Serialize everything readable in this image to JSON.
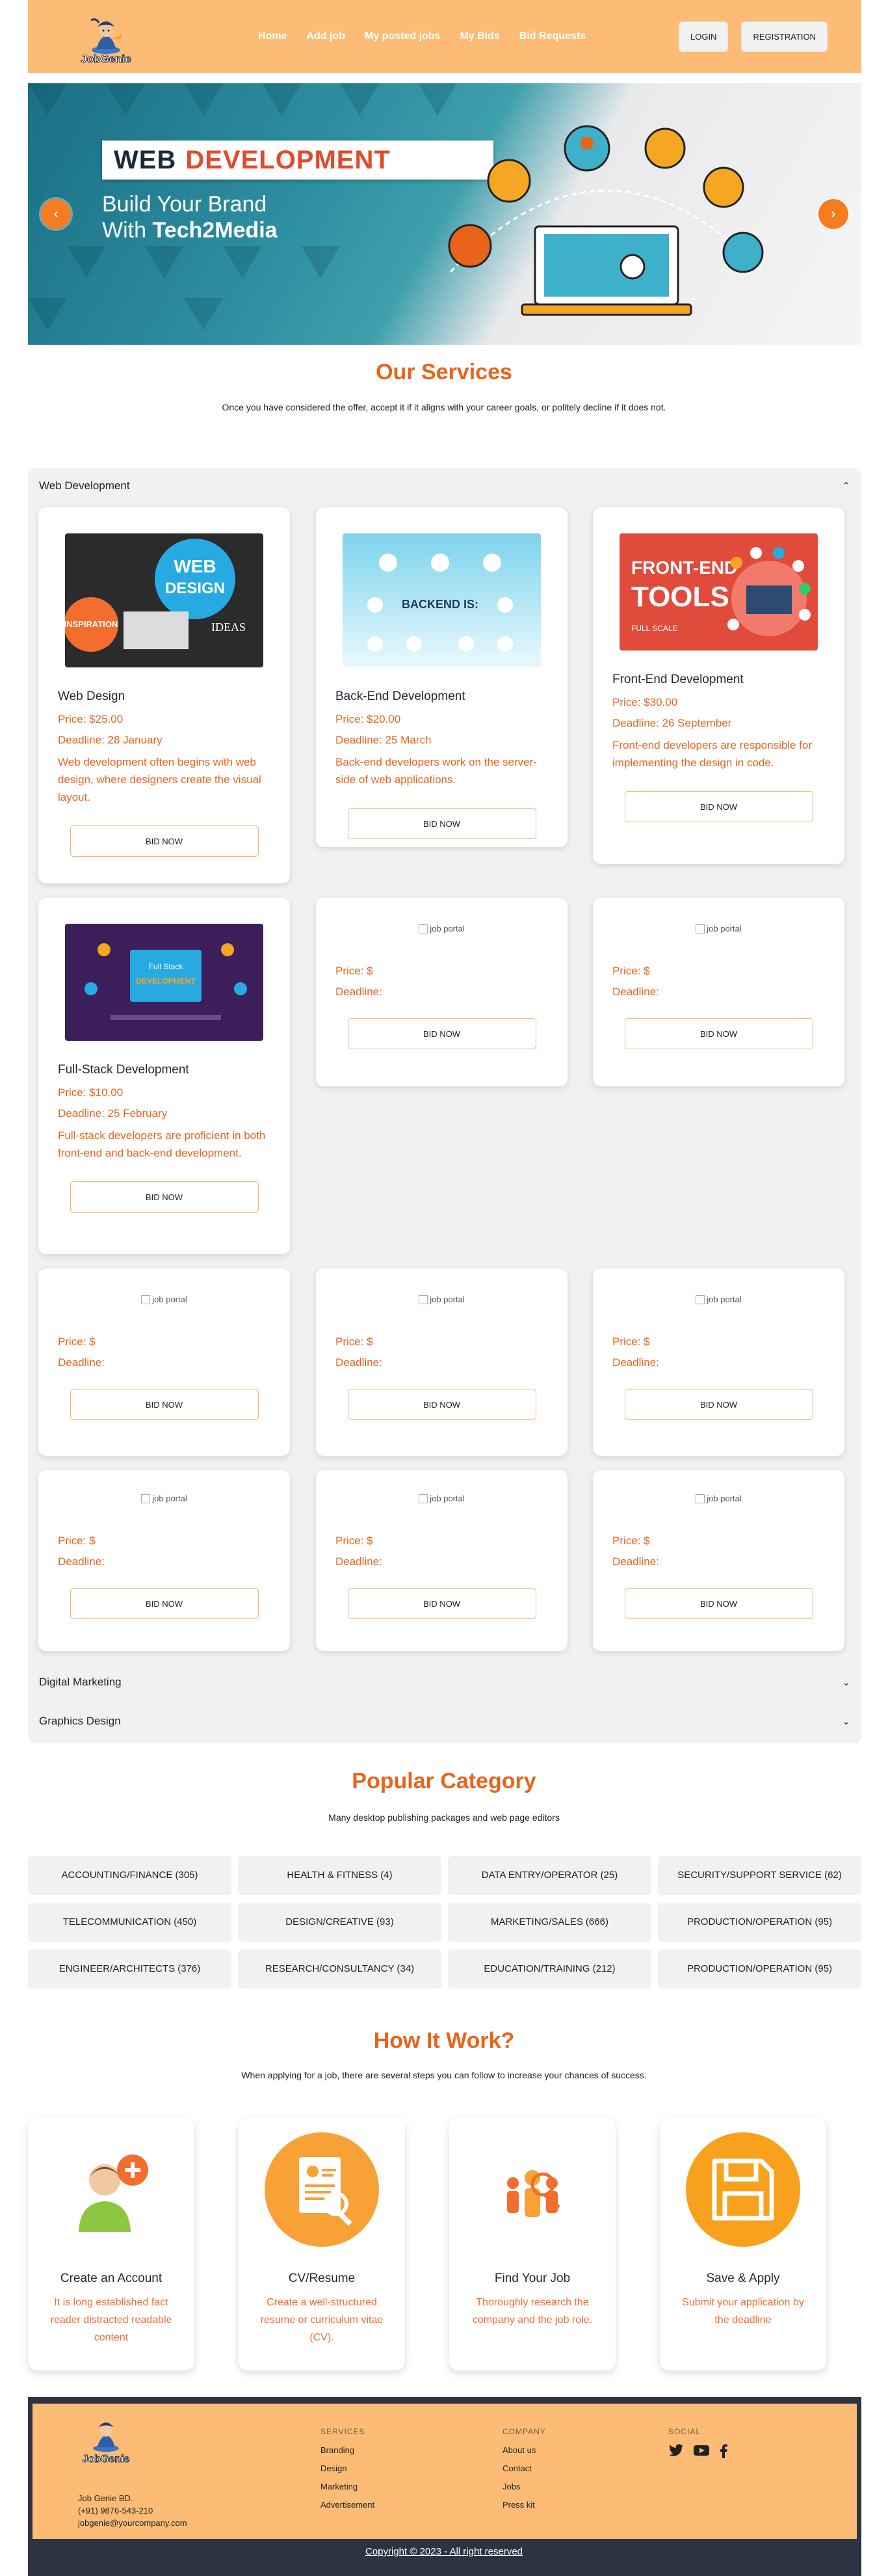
{
  "nav": {
    "logo_text": "JobGenie",
    "links": [
      "Home",
      "Add job",
      "My posted jobs",
      "My Bids",
      "Bid Requests"
    ],
    "login": "LOGIN",
    "registration": "REGISTRATION"
  },
  "hero": {
    "banner_word1": "WEB",
    "banner_word2": "DEVELOPMENT",
    "line1": "Build Your Brand",
    "line2_prefix": "With ",
    "line2_brand": "Tech2Media",
    "prev": "‹",
    "next": "›"
  },
  "services": {
    "title": "Our Services",
    "subtitle": "Once you have considered the offer, accept it if it aligns with your career goals, or politely decline if it does not."
  },
  "accordion": {
    "web": "Web Development",
    "digital": "Digital Marketing",
    "graphics": "Graphics Design",
    "chev_up": "⌃",
    "chev_down": "⌄"
  },
  "cards": [
    {
      "title": "Web Design",
      "price": "Price: $25.00",
      "deadline": "Deadline: 28 January",
      "desc": "Web development often begins with web design, where designers create the visual layout.",
      "img_text1": "WEB",
      "img_text2": "DESIGN",
      "img_text3": "INSPIRATION",
      "img_text4": "IDEAS"
    },
    {
      "title": "Back-End Development",
      "price": "Price: $20.00",
      "deadline": "Deadline: 25 March",
      "desc": "Back-end developers work on the server-side of web applications.",
      "img_text1": "BACKEND IS:"
    },
    {
      "title": "Front-End Development",
      "price": "Price: $30.00",
      "deadline": "Deadline: 26 September",
      "desc": "Front-end developers are responsible for implementing the design in code.",
      "img_text1": "FRONT-END",
      "img_text2": "TOOLS",
      "img_text3": "FULL SCALE"
    },
    {
      "title": "Full-Stack Development",
      "price": "Price: $10.00",
      "deadline": "Deadline: 25 February",
      "desc": "Full-stack developers are proficient in both front-end and back-end development.",
      "img_text1": "Full Stack",
      "img_text2": "DEVELOPMENT"
    }
  ],
  "empty_card": {
    "alt": "job portal",
    "price": "Price: $",
    "deadline": "Deadline:"
  },
  "bid_label": "BID NOW",
  "category": {
    "title": "Popular Category",
    "subtitle": "Many desktop publishing packages and web page editors",
    "items": [
      "ACCOUNTING/FINANCE (305)",
      "HEALTH & FITNESS (4)",
      "DATA ENTRY/OPERATOR (25)",
      "SECURITY/SUPPORT SERVICE (62)",
      "TELECOMMUNICATION (450)",
      "DESIGN/CREATIVE (93)",
      "MARKETING/SALES (666)",
      "PRODUCTION/OPERATION (95)",
      "ENGINEER/ARCHITECTS (376)",
      "RESEARCH/CONSULTANCY (34)",
      "EDUCATION/TRAINING (212)",
      "PRODUCTION/OPERATION (95)"
    ]
  },
  "how": {
    "title": "How It Work?",
    "subtitle": "When applying for a job, there are several steps you can follow to increase your chances of success.",
    "steps": [
      {
        "title": "Create an Account",
        "desc": "It is long established fact reader distracted readable content"
      },
      {
        "title": "CV/Resume",
        "desc": "Create a well-structured resume or curriculum vitae (CV)."
      },
      {
        "title": "Find Your Job",
        "desc": "Thoroughly research the company and the job role."
      },
      {
        "title": "Save & Apply",
        "desc": "Submit your application by the deadline"
      }
    ]
  },
  "footer": {
    "logo_text": "JobGenie",
    "services_title": "SERVICES",
    "services": [
      "Branding",
      "Design",
      "Marketing",
      "Advertisement"
    ],
    "company_title": "COMPANY",
    "company": [
      "About us",
      "Contact",
      "Jobs",
      "Press kit"
    ],
    "social_title": "SOCIAL",
    "contact": [
      "Job Genie BD.",
      "(+91) 9876-543-210",
      "jobgenie@yourcompany.com"
    ],
    "copyright": "Copyright © 2023 - All right reserved"
  },
  "colors": {
    "accent": "#e8641b",
    "nav_bg": "#fdbc75",
    "footer_bg": "#2d3441"
  }
}
